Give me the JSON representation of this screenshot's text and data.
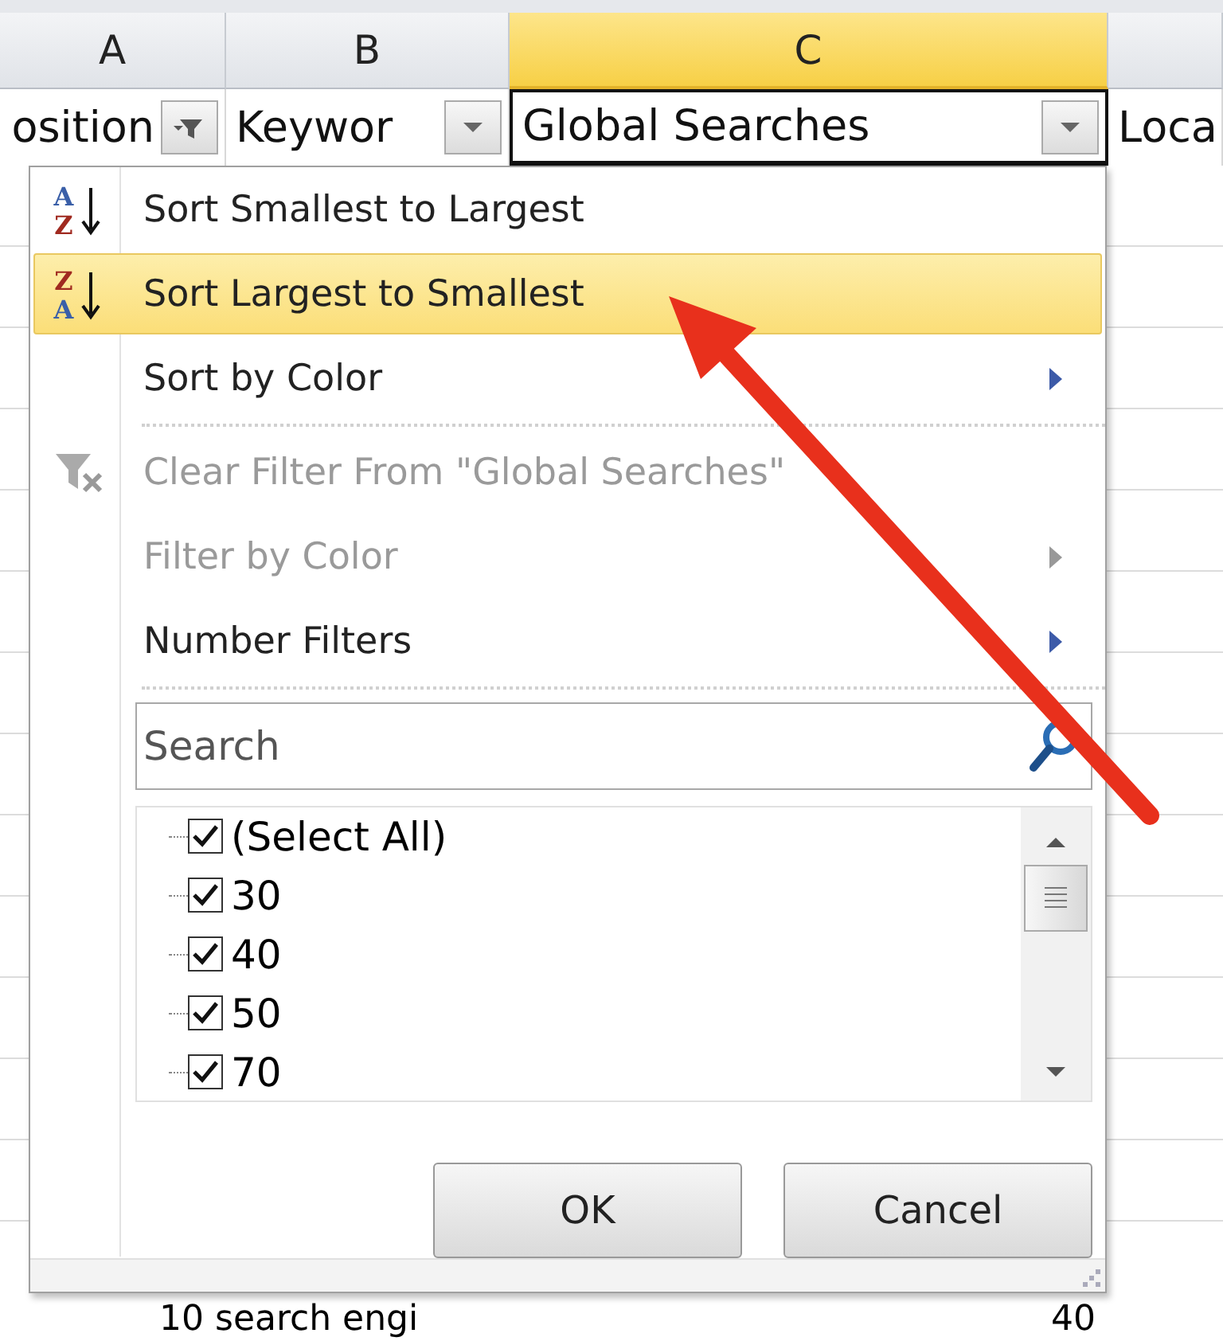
{
  "column_headers": [
    {
      "label": "A",
      "selected": false
    },
    {
      "label": "B",
      "selected": false
    },
    {
      "label": "C",
      "selected": true
    }
  ],
  "header_row": [
    {
      "text": "osition",
      "kind": "filtered",
      "selected": false
    },
    {
      "text": "Keywor",
      "kind": "dropdown",
      "selected": false
    },
    {
      "text": "Global Searches",
      "kind": "dropdown",
      "selected": true
    },
    {
      "text": "Loca",
      "kind": "plain",
      "selected": false
    }
  ],
  "filter_menu": {
    "items": [
      {
        "kind": "sort",
        "label": "Sort Smallest to Largest",
        "icon_letters": [
          "A",
          "Z"
        ],
        "highlighted": false,
        "disabled": false,
        "submenu": false
      },
      {
        "kind": "sort",
        "label": "Sort Largest to Smallest",
        "icon_letters": [
          "Z",
          "A"
        ],
        "highlighted": true,
        "disabled": false,
        "submenu": false
      },
      {
        "kind": "command",
        "label": "Sort by Color",
        "highlighted": false,
        "disabled": false,
        "submenu": true
      },
      {
        "kind": "separator"
      },
      {
        "kind": "clear",
        "label": "Clear Filter From \"Global Searches\"",
        "highlighted": false,
        "disabled": true,
        "submenu": false
      },
      {
        "kind": "command",
        "label": "Filter by Color",
        "highlighted": false,
        "disabled": true,
        "submenu": true
      },
      {
        "kind": "command",
        "label": "Number Filters",
        "highlighted": false,
        "disabled": false,
        "submenu": true
      },
      {
        "kind": "separator"
      }
    ],
    "search": {
      "placeholder": "Search"
    },
    "values": [
      {
        "label": "(Select All)",
        "checked": true
      },
      {
        "label": "30",
        "checked": true
      },
      {
        "label": "40",
        "checked": true
      },
      {
        "label": "50",
        "checked": true
      },
      {
        "label": "70",
        "checked": true
      }
    ],
    "buttons": [
      {
        "label": "OK"
      },
      {
        "label": "Cancel"
      }
    ]
  },
  "row_behind": [
    "10 search engi",
    "40"
  ]
}
